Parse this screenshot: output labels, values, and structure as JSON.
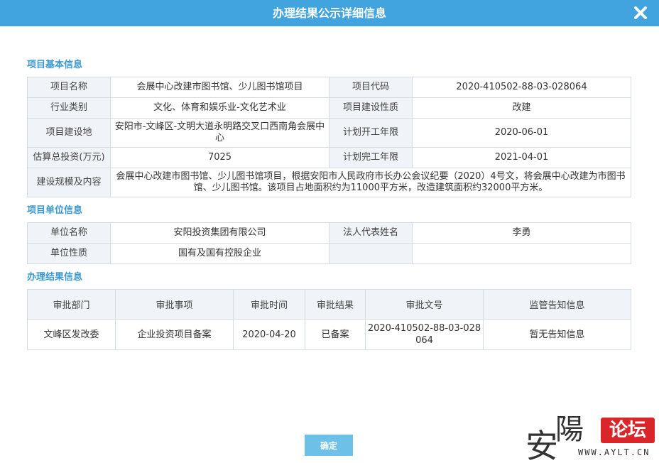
{
  "dialog": {
    "title": "办理结果公示详细信息",
    "confirm_label": "确定"
  },
  "basic": {
    "section_title": "项目基本信息",
    "labels": {
      "name": "项目名称",
      "code": "项目代码",
      "industry": "行业类别",
      "nature": "项目建设性质",
      "location": "项目建设地",
      "start": "计划开工年限",
      "investment": "估算总投资(万元)",
      "finish": "计划完工年限",
      "scale": "建设规模及内容"
    },
    "values": {
      "name": "会展中心改建市图书馆、少儿图书馆项目",
      "code": "2020-410502-88-03-028064",
      "industry": "文化、体育和娱乐业-文化艺术业",
      "nature": "改建",
      "location": "安阳市-文峰区-文明大道永明路交叉口西南角会展中心",
      "start": "2020-06-01",
      "investment": "7025",
      "finish": "2021-04-01",
      "scale": "会展中心改建市图书馆、少儿图书馆项目，根据安阳市人民政府市长办公会议纪要（2020）4号文，将会展中心改建为市图书馆、少儿图书馆。该项目占地面积约为11000平方米，改造建筑面积约32000平方米。"
    }
  },
  "unit": {
    "section_title": "项目单位信息",
    "labels": {
      "name": "单位名称",
      "legal": "法人代表姓名",
      "nature": "单位性质"
    },
    "values": {
      "name": "安阳投资集团有限公司",
      "legal": "李勇",
      "nature": "国有及国有控股企业"
    }
  },
  "result": {
    "section_title": "办理结果信息",
    "headers": [
      "审批部门",
      "审批事项",
      "审批时间",
      "审批结果",
      "审批文号",
      "监管告知信息"
    ],
    "rows": [
      [
        "文峰区发改委",
        "企业投资项目备案",
        "2020-04-20",
        "已备案",
        "2020-410502-88-03-028064",
        "暂无告知信息"
      ]
    ]
  },
  "watermark": {
    "char1": "安",
    "char2": "陽",
    "forum": "论坛",
    "url": "WWW.AYLT.CN"
  }
}
